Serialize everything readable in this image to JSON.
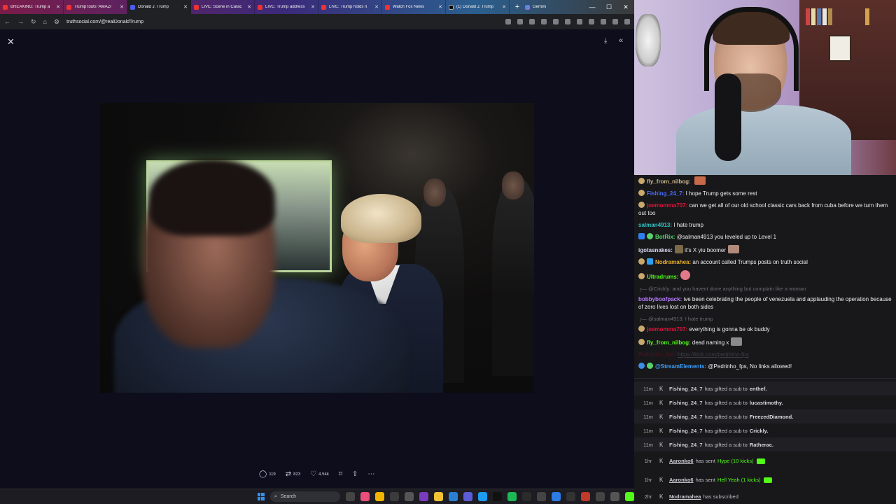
{
  "browser": {
    "tabs": [
      {
        "title": "BREAKING: Trump a",
        "icon": "youtube-icon"
      },
      {
        "title": "Trump touts 'AMAZI",
        "icon": "youtube-icon"
      },
      {
        "title": "Donald J. Trump",
        "icon": "truth-social-icon"
      },
      {
        "title": "LIVE: Scene in Carac",
        "icon": "youtube-icon"
      },
      {
        "title": "LIVE: Trump address",
        "icon": "youtube-icon"
      },
      {
        "title": "LIVE: Trump holds n",
        "icon": "youtube-icon"
      },
      {
        "title": "Watch Fox News",
        "icon": "fox-news-icon"
      },
      {
        "title": "(1) Donald J. Trump",
        "icon": "x-icon"
      },
      {
        "title": "Gemini",
        "icon": "gemini-icon"
      }
    ],
    "url": "truthsocial.com/@realDonaldTrump"
  },
  "post": {
    "replies": "119",
    "reposts": "823",
    "likes": "4.54k"
  },
  "taskbar": {
    "search_label": "Search"
  },
  "chat": {
    "messages": [
      {
        "user": "fly_from_nilbog:",
        "text": "",
        "user_color": "#c9b68a"
      },
      {
        "user": "Fishing_24_7:",
        "text": "I hope Trump gets some rest",
        "user_color": "#4a6cff"
      },
      {
        "user": "joemomma707:",
        "text": "can we get all of our old school classic cars back from cuba before we turn them out too",
        "user_color": "#e0143a"
      },
      {
        "user": "salman4913:",
        "text": "I hate trump",
        "user_color": "#2ec5c5"
      },
      {
        "user": "BotRix:",
        "text": "@salman4913 you leveled up to Level 1",
        "user_color": "#58d36b"
      },
      {
        "user": "igotasnakes:",
        "text": "it's X yiu boomer",
        "user_color": "#d9d9f0"
      },
      {
        "user": "Nodramahea:",
        "text": "an account called Trumps posts on truth social",
        "user_color": "#e8ad2a"
      },
      {
        "user": "Ultradrums:",
        "text": "",
        "user_color": "#53fc18"
      },
      {
        "reply": "@Crickly: and you havent done anything but complain like a woman"
      },
      {
        "user": "bobbyboofpack:",
        "text": "ive been celebrating the people of venezuela and applauding the operation because of zero lives lost on both sides",
        "user_color": "#b57bff"
      },
      {
        "reply": "@salman4913: I hate trump"
      },
      {
        "user": "joemomma707:",
        "text": "everything is gonna be ok buddy",
        "user_color": "#e0143a"
      },
      {
        "user": "fly_from_nilbog:",
        "text": "dead naming x",
        "user_color": "#53fc18"
      },
      {
        "user": "Pedrinho_fps:",
        "text": "https://kick.com/pedrinho-fps",
        "user_color": "#6b1020",
        "deleted": true
      },
      {
        "user": "@StreamElements:",
        "text": "@Pedrinho_fps, No links allowed!",
        "user_color": "#3aa0ff"
      }
    ]
  },
  "events": [
    {
      "time": "11m",
      "who": "Fishing_24_7",
      "action": "has gifted a sub to",
      "target": "enthef."
    },
    {
      "time": "11m",
      "who": "Fishing_24_7",
      "action": "has gifted a sub to",
      "target": "lucastimothy."
    },
    {
      "time": "11m",
      "who": "Fishing_24_7",
      "action": "has gifted a sub to",
      "target": "FreezedDiamond."
    },
    {
      "time": "11m",
      "who": "Fishing_24_7",
      "action": "has gifted a sub to",
      "target": "Crickly."
    },
    {
      "time": "11m",
      "who": "Fishing_24_7",
      "action": "has gifted a sub to",
      "target": "Ratherac."
    },
    {
      "time": "1hr",
      "who": "Aaronko6",
      "action": "has sent",
      "target": "Hype (10 kicks)"
    },
    {
      "time": "1hr",
      "who": "Aaronko6",
      "action": "has sent",
      "target": "Hell Yeah (1 kicks)"
    },
    {
      "time": "2hr",
      "who": "Nodramahea",
      "action": "has subscribed",
      "target": ""
    }
  ],
  "colors": {
    "kick_green": "#53fc18",
    "chat_bg": "#18181b",
    "viewer_bg": "#0d0d1c"
  }
}
